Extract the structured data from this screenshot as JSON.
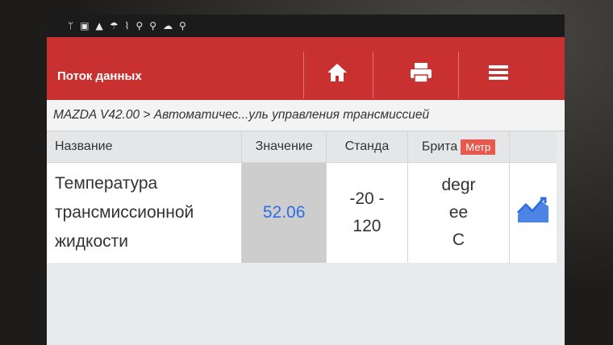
{
  "statusbar": {
    "icons": [
      "usb-icon",
      "image-icon",
      "warning-icon",
      "umbrella-icon",
      "wifi-icon",
      "vci-icon",
      "vci-icon",
      "cloud-icon",
      "search-icon"
    ]
  },
  "appbar": {
    "title": "Поток данных",
    "actions": [
      "home-icon",
      "print-icon",
      "menu-icon"
    ],
    "color": "#c8312f"
  },
  "breadcrumb": "MAZDA V42.00 > Автоматичес...уль управления трансмиссией",
  "table": {
    "headers": {
      "name": "Название",
      "value": "Значение",
      "standard": "Станда",
      "unit": "Брита",
      "unit_badge": "Метр"
    },
    "rows": [
      {
        "name_lines": [
          "Температура",
          "трансмиссионной",
          "жидкости"
        ],
        "value": "52.06",
        "standard_lines": [
          "-20 -",
          "120"
        ],
        "unit_lines": [
          "degr",
          "ee",
          "C"
        ]
      }
    ]
  },
  "colors": {
    "value_text": "#2e6ee0",
    "graph_icon": "#2e6ee0"
  }
}
